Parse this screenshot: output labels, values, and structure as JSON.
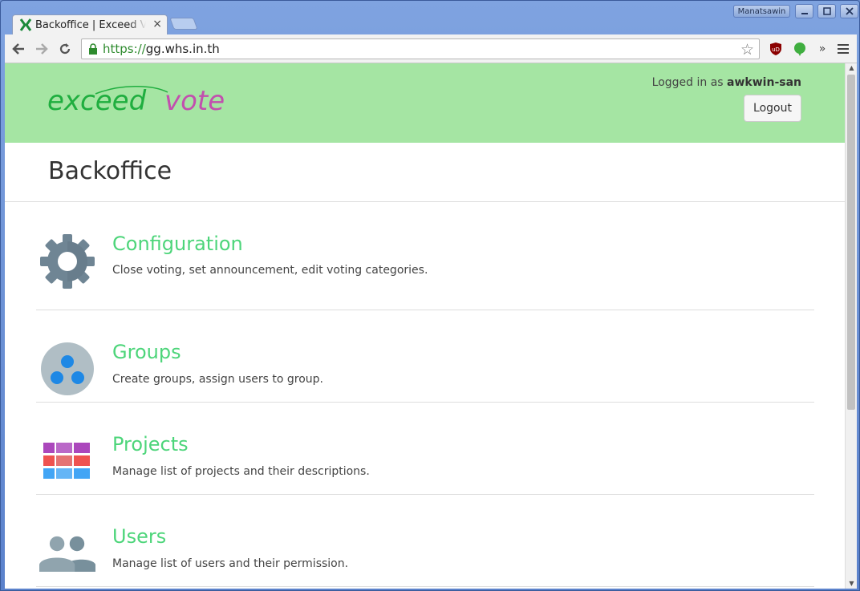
{
  "browser": {
    "tab_title": "Backoffice | Exceed Vote",
    "tab_close": "×",
    "profile_name": "Manatsawin",
    "url_scheme": "https://",
    "url_host": "gg.whs.in.th"
  },
  "header": {
    "logo_text_green": "exceed",
    "logo_text_pink": "vote",
    "logged_in_prefix": "Logged in as ",
    "username": "awkwin-san",
    "logout_label": "Logout"
  },
  "page": {
    "title": "Backoffice"
  },
  "menu": [
    {
      "title": "Configuration",
      "description": "Close voting, set announcement, edit voting categories.",
      "icon": "gear-icon"
    },
    {
      "title": "Groups",
      "description": "Create groups, assign users to group.",
      "icon": "groups-icon"
    },
    {
      "title": "Projects",
      "description": "Manage list of projects and their descriptions.",
      "icon": "projects-icon"
    },
    {
      "title": "Users",
      "description": "Manage list of users and their permission.",
      "icon": "users-icon"
    }
  ],
  "colors": {
    "header_bg": "#a5e5a3",
    "link_green": "#4dd57a",
    "logo_green": "#1fae3f",
    "logo_pink": "#c24fae"
  }
}
